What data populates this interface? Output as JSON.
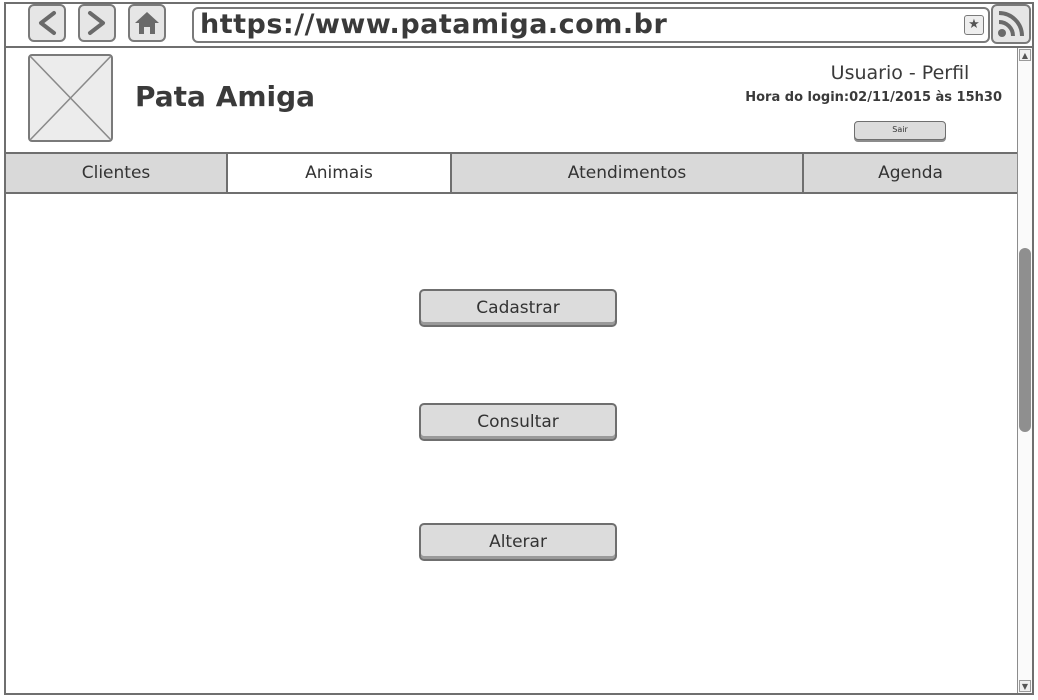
{
  "browser": {
    "url": "https://www.patamiga.com.br",
    "icons": [
      "back-arrow-icon",
      "forward-arrow-icon",
      "home-icon",
      "star-icon",
      "rss-icon"
    ]
  },
  "header": {
    "site_title": "Pata Amiga",
    "user_profile": "Usuario - Perfil",
    "login_time": "Hora do login:02/11/2015 às 15h30",
    "logout_label": "Sair"
  },
  "tabs": [
    {
      "label": "Clientes",
      "active": false
    },
    {
      "label": "Animais",
      "active": true
    },
    {
      "label": "Atendimentos",
      "active": false
    },
    {
      "label": "Agenda",
      "active": false
    }
  ],
  "actions": {
    "register_label": "Cadastrar",
    "search_label": "Consultar",
    "edit_label": "Alterar"
  },
  "colors": {
    "border": "#6f6f6f",
    "button_fill": "#dcdcdc",
    "active_tab": "#ffffff",
    "inactive_tab": "#d9d9d9",
    "text": "#333333"
  }
}
